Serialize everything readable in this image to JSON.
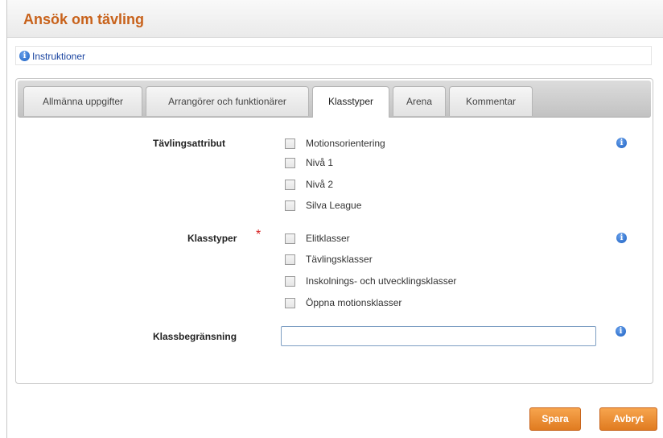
{
  "page": {
    "title": "Ansök om tävling"
  },
  "instructions": {
    "label": "Instruktioner",
    "icon": "info-icon"
  },
  "tabs": [
    {
      "label": "Allmänna uppgifter",
      "active": false
    },
    {
      "label": "Arrangörer och funktionärer",
      "active": false
    },
    {
      "label": "Klasstyper",
      "active": true
    },
    {
      "label": "Arena",
      "active": false
    },
    {
      "label": "Kommentar",
      "active": false
    }
  ],
  "form": {
    "attributes": {
      "label": "Tävlingsattribut",
      "options": [
        "Motionsorientering",
        "Nivå 1",
        "Nivå 2",
        "Silva League"
      ]
    },
    "class_types": {
      "label": "Klasstyper",
      "required_marker": "*",
      "options": [
        "Elitklasser",
        "Tävlingsklasser",
        "Inskolnings- och utvecklingsklasser",
        "Öppna motionsklasser"
      ]
    },
    "class_limit": {
      "label": "Klassbegränsning",
      "value": ""
    }
  },
  "buttons": {
    "save": "Spara",
    "cancel": "Avbryt"
  },
  "colors": {
    "accent": "#c8621b",
    "button": "#ef8f32",
    "link": "#1a44a0",
    "required": "#d62020",
    "info": "#1b5fc1"
  }
}
